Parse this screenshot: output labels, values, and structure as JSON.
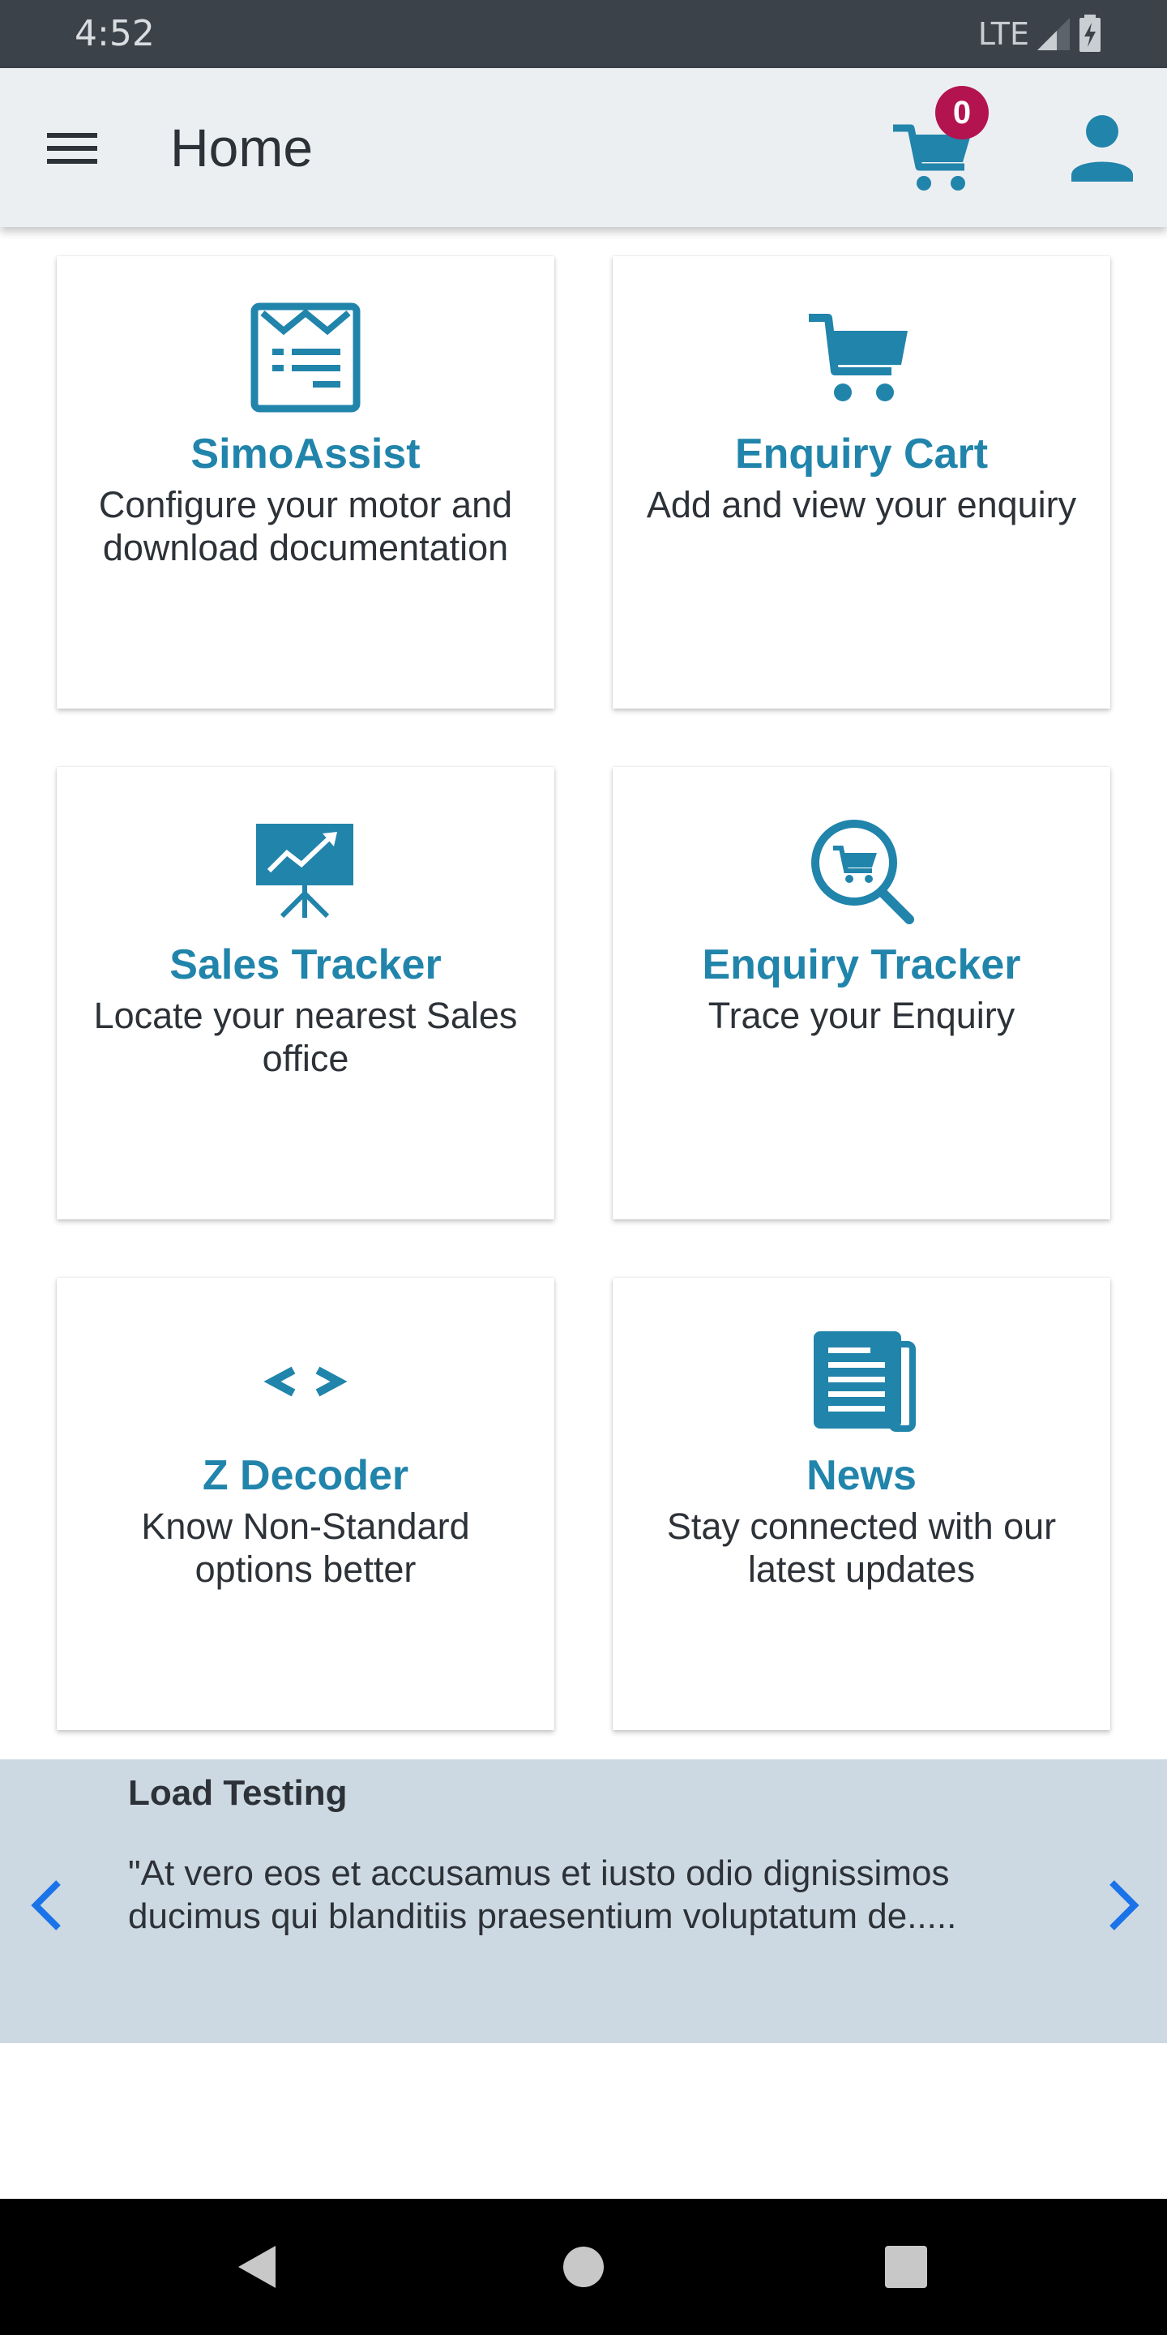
{
  "status_bar": {
    "time": "4:52",
    "network": "LTE"
  },
  "app_bar": {
    "title": "Home",
    "cart_count": "0",
    "icons": {
      "menu": "hamburger-menu-icon",
      "cart": "cart-icon",
      "profile": "person-icon"
    }
  },
  "cards": [
    {
      "title": "SimoAssist",
      "description": "Configure your motor and download documentation",
      "icon": "document-form-icon"
    },
    {
      "title": "Enquiry Cart",
      "description": "Add and view your enquiry",
      "icon": "cart-icon"
    },
    {
      "title": "Sales Tracker",
      "description": "Locate your nearest Sales office",
      "icon": "presentation-chart-icon"
    },
    {
      "title": "Enquiry Tracker",
      "description": "Trace your Enquiry",
      "icon": "search-cart-icon"
    },
    {
      "title": "Z Decoder",
      "description": "Know Non-Standard options better",
      "icon": "code-brackets-icon"
    },
    {
      "title": "News",
      "description": "Stay connected with our latest updates",
      "icon": "newspaper-icon"
    }
  ],
  "news_banner": {
    "title": "Load Testing",
    "text": "\"At vero eos et accusamus et iusto odio dignissimos ducimus qui blanditiis praesentium voluptatum de....."
  },
  "colors": {
    "accent": "#2184ab",
    "badge": "#b3134e",
    "app_bar_bg": "#eceff2",
    "banner_bg": "#cdd9e2",
    "arrow": "#1a73e8"
  }
}
